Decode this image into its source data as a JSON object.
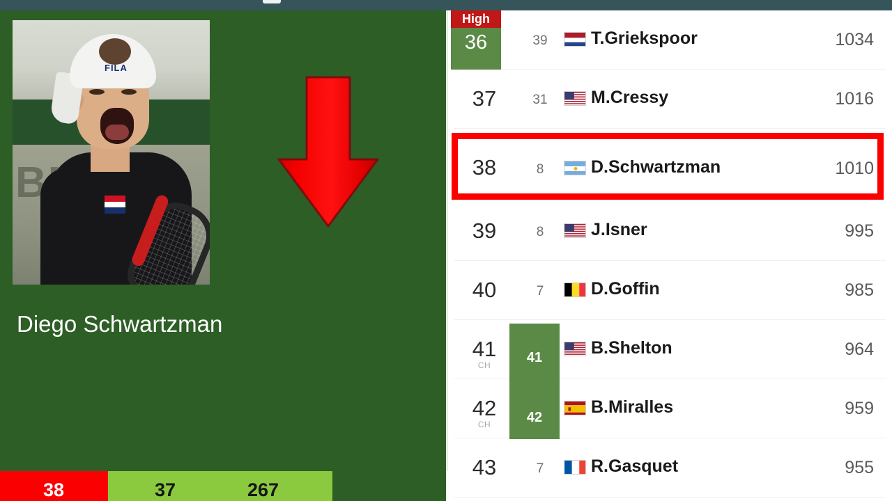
{
  "top_bar": {
    "color": "#36555a"
  },
  "player_card": {
    "name": "Diego Schwartzman",
    "photo_alt": "diego-schwartzman-photo",
    "trend_icon": "red-down-arrow-icon",
    "background_color": "#2d5e26"
  },
  "summary_bar": {
    "current_rank": "38",
    "previous_rank": "37",
    "points": "267",
    "rank_box_color": "#fb0000",
    "stats_box_color": "#8bc93f"
  },
  "ranking_table": {
    "high_badge_label": "High",
    "high_badge_color": "#c01717",
    "highlight_color": "#5b8a46",
    "focus_border_color": "#fb0000",
    "career_high_label": "CH",
    "rows": [
      {
        "rank": "36",
        "prev": "39",
        "flag": "netherlands-flag",
        "name": "T.Griekspoor",
        "points": "1034",
        "marker": "high",
        "marker_value": "36"
      },
      {
        "rank": "37",
        "prev": "31",
        "flag": "usa-flag",
        "name": "M.Cressy",
        "points": "1016",
        "marker": "none",
        "marker_value": ""
      },
      {
        "rank": "38",
        "prev": "8",
        "flag": "argentina-flag",
        "name": "D.Schwartzman",
        "points": "1010",
        "marker": "focus",
        "marker_value": ""
      },
      {
        "rank": "39",
        "prev": "8",
        "flag": "usa-flag",
        "name": "J.Isner",
        "points": "995",
        "marker": "none",
        "marker_value": ""
      },
      {
        "rank": "40",
        "prev": "7",
        "flag": "belgium-flag",
        "name": "D.Goffin",
        "points": "985",
        "marker": "none",
        "marker_value": ""
      },
      {
        "rank": "41",
        "prev": "",
        "flag": "usa-flag",
        "name": "B.Shelton",
        "points": "964",
        "marker": "ch",
        "marker_value": "41"
      },
      {
        "rank": "42",
        "prev": "",
        "flag": "spain-flag",
        "name": "B.Miralles",
        "points": "959",
        "marker": "ch",
        "marker_value": "42"
      },
      {
        "rank": "43",
        "prev": "7",
        "flag": "france-flag",
        "name": "R.Gasquet",
        "points": "955",
        "marker": "none",
        "marker_value": ""
      }
    ]
  }
}
